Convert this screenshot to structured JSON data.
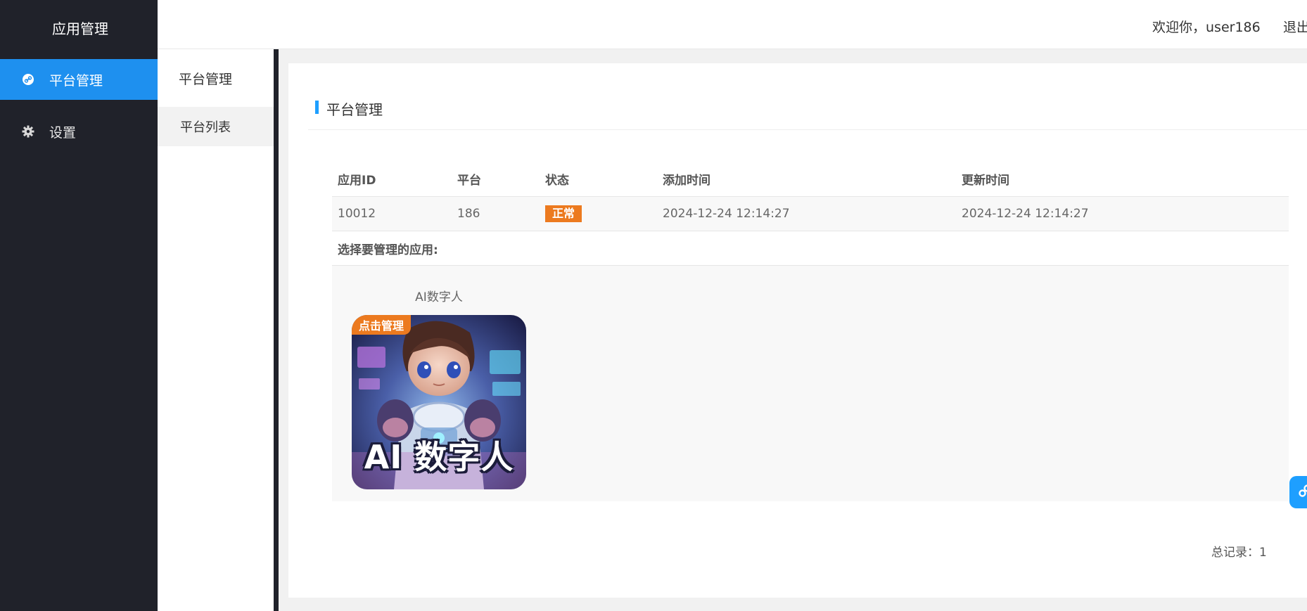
{
  "sidebar": {
    "brand": "应用管理",
    "items": [
      {
        "label": "平台管理",
        "icon": "link-icon",
        "active": true
      },
      {
        "label": "设置",
        "icon": "gear-icon",
        "active": false
      }
    ]
  },
  "header": {
    "welcome": "欢迎你，user186",
    "logout": "退出"
  },
  "submenu": {
    "title": "平台管理",
    "items": [
      {
        "label": "平台列表"
      }
    ]
  },
  "main": {
    "title": "平台管理",
    "table": {
      "columns": [
        "应用ID",
        "平台",
        "状态",
        "添加时间",
        "更新时间"
      ],
      "rows": [
        {
          "app_id": "10012",
          "platform": "186",
          "status": "正常",
          "created": "2024-12-24 12:14:27",
          "updated": "2024-12-24 12:14:27"
        }
      ]
    },
    "select_label": "选择要管理的应用:",
    "apps": [
      {
        "name": "AI数字人",
        "tag": "点击管理",
        "thumb_text": "AI 数字人"
      }
    ],
    "total": "总记录：1"
  },
  "colors": {
    "sidebar_bg": "#20222a",
    "accent": "#1e90ef",
    "status_badge": "#ec7a1f"
  }
}
